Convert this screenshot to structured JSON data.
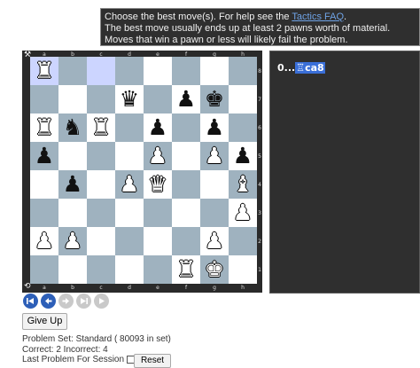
{
  "info": {
    "line1_prefix": "Choose the best move(s). For help see the ",
    "line1_link": "Tactics FAQ",
    "line1_suffix": ".",
    "line2": "The best move usually ends up at least 2 pawns worth of material.",
    "line3": "Moves that win a pawn or less will likely fail the problem."
  },
  "board": {
    "files": [
      "a",
      "b",
      "c",
      "d",
      "e",
      "f",
      "g",
      "h"
    ],
    "ranks": [
      "8",
      "7",
      "6",
      "5",
      "4",
      "3",
      "2",
      "1"
    ],
    "highlighted_squares": [
      "a8",
      "c8"
    ],
    "pieces": {
      "a8": {
        "glyph": "♜",
        "color": "white",
        "name": "white-rook"
      },
      "d7": {
        "glyph": "♛",
        "color": "black",
        "name": "black-queen"
      },
      "f7": {
        "glyph": "♟",
        "color": "black",
        "name": "black-pawn"
      },
      "g7": {
        "glyph": "♚",
        "color": "black",
        "name": "black-king"
      },
      "a6": {
        "glyph": "♜",
        "color": "white",
        "name": "white-rook"
      },
      "b6": {
        "glyph": "♞",
        "color": "black",
        "name": "black-knight"
      },
      "c6": {
        "glyph": "♜",
        "color": "white",
        "name": "white-rook"
      },
      "e6": {
        "glyph": "♟",
        "color": "black",
        "name": "black-pawn"
      },
      "g6": {
        "glyph": "♟",
        "color": "black",
        "name": "black-pawn"
      },
      "a5": {
        "glyph": "♟",
        "color": "black",
        "name": "black-pawn"
      },
      "e5": {
        "glyph": "♟",
        "color": "white",
        "name": "white-pawn"
      },
      "g5": {
        "glyph": "♟",
        "color": "white",
        "name": "white-pawn"
      },
      "h5": {
        "glyph": "♟",
        "color": "black",
        "name": "black-pawn"
      },
      "b4": {
        "glyph": "♟",
        "color": "black",
        "name": "black-pawn"
      },
      "d4": {
        "glyph": "♟",
        "color": "white",
        "name": "white-pawn"
      },
      "e4": {
        "glyph": "♛",
        "color": "white",
        "name": "white-queen"
      },
      "h4": {
        "glyph": "♝",
        "color": "white",
        "name": "white-bishop"
      },
      "h3": {
        "glyph": "♟",
        "color": "white",
        "name": "white-pawn"
      },
      "a2": {
        "glyph": "♟",
        "color": "white",
        "name": "white-pawn"
      },
      "b2": {
        "glyph": "♟",
        "color": "white",
        "name": "white-pawn"
      },
      "g2": {
        "glyph": "♟",
        "color": "white",
        "name": "white-pawn"
      },
      "f1": {
        "glyph": "♜",
        "color": "white",
        "name": "white-rook"
      },
      "g1": {
        "glyph": "♚",
        "color": "white",
        "name": "white-king"
      }
    }
  },
  "moves": {
    "prefix": "0...",
    "move_piece": "♖",
    "move_square": "ca8"
  },
  "buttons": {
    "give_up": "Give Up",
    "reset": "Reset"
  },
  "stats": {
    "problem_set": "Problem Set: Standard ( 80093 in set)",
    "score": "Correct: 2 Incorrect: 4",
    "last_problem": "Last Problem For Session"
  },
  "colors": {
    "light_square": "#ffffff",
    "dark_square": "#9fb2bf",
    "highlight": "#ccd5ff",
    "nav_active": "#2d5fb8"
  }
}
